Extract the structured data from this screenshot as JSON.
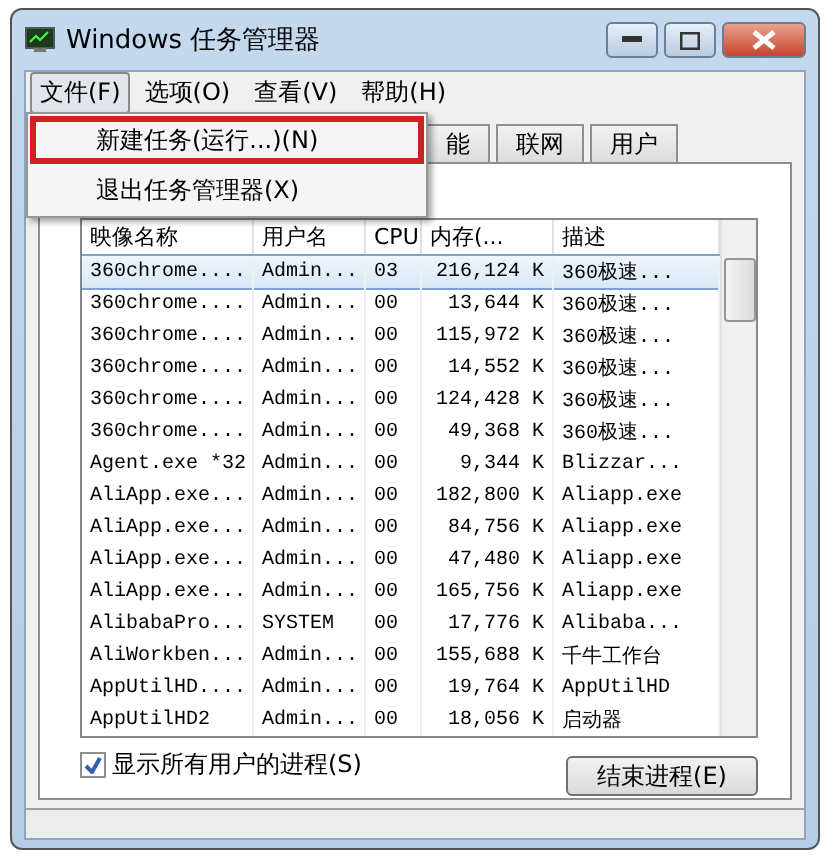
{
  "window": {
    "title": "Windows 任务管理器"
  },
  "menu": [
    {
      "label": "文件(F)",
      "selected": true
    },
    {
      "label": "选项(O)",
      "selected": false
    },
    {
      "label": "查看(V)",
      "selected": false
    },
    {
      "label": "帮助(H)",
      "selected": false
    }
  ],
  "dropdown": [
    {
      "label": "新建任务(运行...)(N)",
      "highlighted": true
    },
    {
      "label": "退出任务管理器(X)",
      "highlighted": false
    }
  ],
  "tabs": [
    {
      "label": "能",
      "selected": false
    },
    {
      "label": "联网",
      "selected": false
    },
    {
      "label": "用户",
      "selected": false
    }
  ],
  "table": {
    "columns": [
      "映像名称",
      "用户名",
      "CPU",
      "内存(...",
      "描述"
    ],
    "rows": [
      {
        "cells": [
          "360chrome....",
          "Admin...",
          "03",
          "216,124 K",
          "360极速..."
        ],
        "selected": true
      },
      {
        "cells": [
          "360chrome....",
          "Admin...",
          "00",
          "13,644 K",
          "360极速..."
        ],
        "selected": false
      },
      {
        "cells": [
          "360chrome....",
          "Admin...",
          "00",
          "115,972 K",
          "360极速..."
        ],
        "selected": false
      },
      {
        "cells": [
          "360chrome....",
          "Admin...",
          "00",
          "14,552 K",
          "360极速..."
        ],
        "selected": false
      },
      {
        "cells": [
          "360chrome....",
          "Admin...",
          "00",
          "124,428 K",
          "360极速..."
        ],
        "selected": false
      },
      {
        "cells": [
          "360chrome....",
          "Admin...",
          "00",
          "49,368 K",
          "360极速..."
        ],
        "selected": false
      },
      {
        "cells": [
          "Agent.exe *32",
          "Admin...",
          "00",
          "9,344 K",
          "Blizzar..."
        ],
        "selected": false
      },
      {
        "cells": [
          "AliApp.exe...",
          "Admin...",
          "00",
          "182,800 K",
          "Aliapp.exe"
        ],
        "selected": false
      },
      {
        "cells": [
          "AliApp.exe...",
          "Admin...",
          "00",
          "84,756 K",
          "Aliapp.exe"
        ],
        "selected": false
      },
      {
        "cells": [
          "AliApp.exe...",
          "Admin...",
          "00",
          "47,480 K",
          "Aliapp.exe"
        ],
        "selected": false
      },
      {
        "cells": [
          "AliApp.exe...",
          "Admin...",
          "00",
          "165,756 K",
          "Aliapp.exe"
        ],
        "selected": false
      },
      {
        "cells": [
          "AlibabaPro...",
          "SYSTEM",
          "00",
          "17,776 K",
          "Alibaba..."
        ],
        "selected": false
      },
      {
        "cells": [
          "AliWorkben...",
          "Admin...",
          "00",
          "155,688 K",
          "千牛工作台"
        ],
        "selected": false
      },
      {
        "cells": [
          "AppUtilHD....",
          "Admin...",
          "00",
          "19,764 K",
          "AppUtilHD"
        ],
        "selected": false
      },
      {
        "cells": [
          "AppUtilHD2",
          "Admin...",
          "00",
          "18,056 K",
          "启动器"
        ],
        "selected": false
      }
    ]
  },
  "show_all_users": {
    "label": "显示所有用户的进程(S)",
    "checked": true
  },
  "end_button": "结束进程(E)"
}
